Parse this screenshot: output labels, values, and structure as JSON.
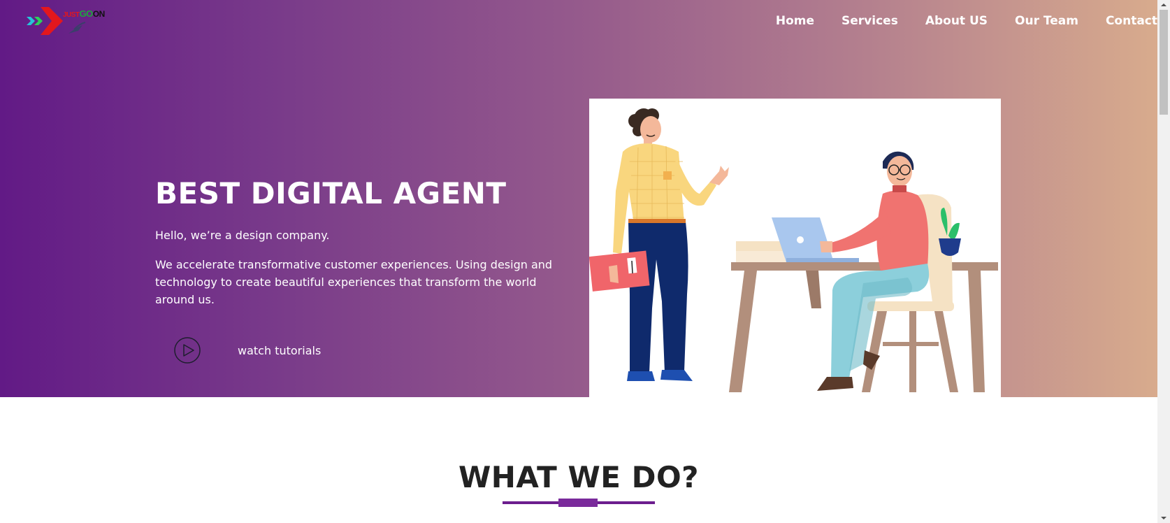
{
  "brand": {
    "logo_words": [
      "JUST",
      "GO",
      "ON"
    ]
  },
  "nav": {
    "items": [
      {
        "label": "Home"
      },
      {
        "label": "Services"
      },
      {
        "label": "About US"
      },
      {
        "label": "Our Team"
      },
      {
        "label": "Contact"
      }
    ]
  },
  "hero": {
    "title": "BEST DIGITAL AGENT",
    "subtitle": "Hello, we’re a design company.",
    "description": "We accelerate transformative customer experiences. Using design and technology to create beautiful experiences that transform the world around us.",
    "watch_label": "watch tutorials",
    "play_icon": "play-circle-icon",
    "illustration": "office-team-illustration"
  },
  "section": {
    "title": "WHAT WE DO?"
  },
  "colors": {
    "gradient_start": "#621a86",
    "gradient_end": "#d8ab8d",
    "accent": "#6c1d8e",
    "heading_dark": "#222222"
  }
}
